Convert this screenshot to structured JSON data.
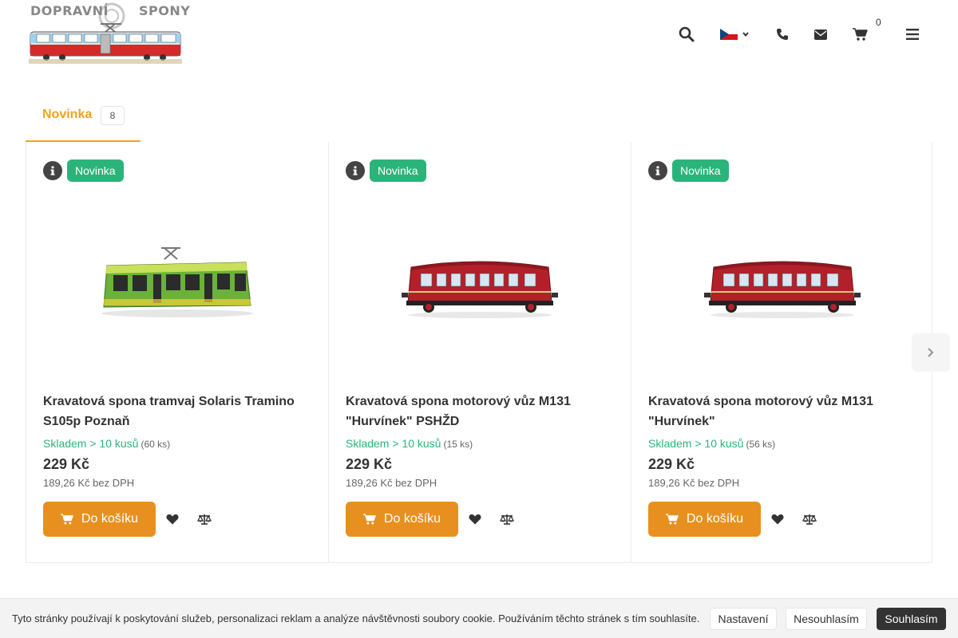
{
  "header": {
    "logo_text_left": "DOPRAVNÍ",
    "logo_text_right": "SPONY",
    "cart_count": "0",
    "icons": [
      "search-icon",
      "czech-flag-icon",
      "phone-icon",
      "envelope-icon",
      "cart-icon",
      "menu-icon"
    ]
  },
  "tabs": [
    {
      "label": "Novinka",
      "count": "8"
    }
  ],
  "products": [
    {
      "badge": "Novinka",
      "name": "Kravatová spona tramvaj Solaris Tramino S105p Poznaň",
      "stock": "Skladem > 10 kusů",
      "stock_count": "(60 ks)",
      "price": "229 Kč",
      "price_novat": "189,26 Kč bez DPH",
      "cart_label": "Do košíku"
    },
    {
      "badge": "Novinka",
      "name": "Kravatová spona motorový vůz M131 \"Hurvínek\" PSHŽD",
      "stock": "Skladem > 10 kusů",
      "stock_count": "(15 ks)",
      "price": "229 Kč",
      "price_novat": "189,26 Kč bez DPH",
      "cart_label": "Do košíku"
    },
    {
      "badge": "Novinka",
      "name": "Kravatová spona motorový vůz M131 \"Hurvínek\"",
      "stock": "Skladem > 10 kusů",
      "stock_count": "(56 ks)",
      "price": "229 Kč",
      "price_novat": "189,26 Kč bez DPH",
      "cart_label": "Do košíku"
    }
  ],
  "cookie": {
    "text": "Tyto stránky používají k poskytování služeb, personalizaci reklam a analýze návštěvnosti soubory cookie. Používáním těchto stránek s tím souhlasíte.",
    "settings": "Nastavení",
    "decline": "Nesouhlasím",
    "accept": "Souhlasím"
  },
  "colors": {
    "accent_orange": "#e8901f",
    "tab_yellow": "#f0a31c",
    "badge_green": "#2bb47a"
  }
}
